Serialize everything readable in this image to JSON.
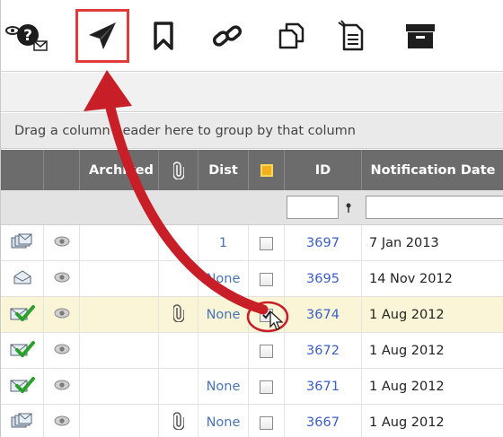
{
  "toolbar": {
    "buttons": [
      {
        "icon": "help-mail-icon"
      },
      {
        "icon": "send-icon",
        "active": true
      },
      {
        "icon": "bookmark-icon"
      },
      {
        "icon": "link-icon"
      },
      {
        "icon": "copy-icon"
      },
      {
        "icon": "document-icon"
      },
      {
        "icon": "archive-box-icon"
      }
    ]
  },
  "group_bar": {
    "text": "Drag a column header here to group by that column"
  },
  "grid": {
    "headers": {
      "archived": "Archived",
      "attachment": "attachment",
      "dist": "Dist",
      "flag": "flag",
      "id": "ID",
      "date": "Notification Date"
    },
    "rows": [
      {
        "status_icon": "read-stack-icon",
        "attachment": false,
        "dist": "1",
        "checked": false,
        "id": "3697",
        "date": "7 Jan 2013",
        "highlight": false
      },
      {
        "status_icon": "open-envelope-icon",
        "attachment": false,
        "dist": "None",
        "checked": false,
        "id": "3695",
        "date": "14 Nov 2012",
        "highlight": false
      },
      {
        "status_icon": "checked-envelope-icon",
        "attachment": true,
        "dist": "None",
        "checked": true,
        "id": "3674",
        "date": "1 Aug 2012",
        "highlight": true
      },
      {
        "status_icon": "checked-envelope-icon",
        "attachment": false,
        "dist": "",
        "checked": false,
        "id": "3672",
        "date": "1 Aug 2012",
        "highlight": false
      },
      {
        "status_icon": "checked-envelope-icon",
        "attachment": false,
        "dist": "None",
        "checked": false,
        "id": "3671",
        "date": "1 Aug 2012",
        "highlight": false
      },
      {
        "status_icon": "read-stack-icon",
        "attachment": true,
        "dist": "None",
        "checked": false,
        "id": "3667",
        "date": "1 Aug 2012",
        "highlight": false
      }
    ]
  },
  "colors": {
    "accent_red": "#d0202a",
    "header_bg": "#6c6c6c",
    "link_blue": "#3a5fc8",
    "check_green": "#2aa12a",
    "flag_yellow": "#f2b01e"
  }
}
